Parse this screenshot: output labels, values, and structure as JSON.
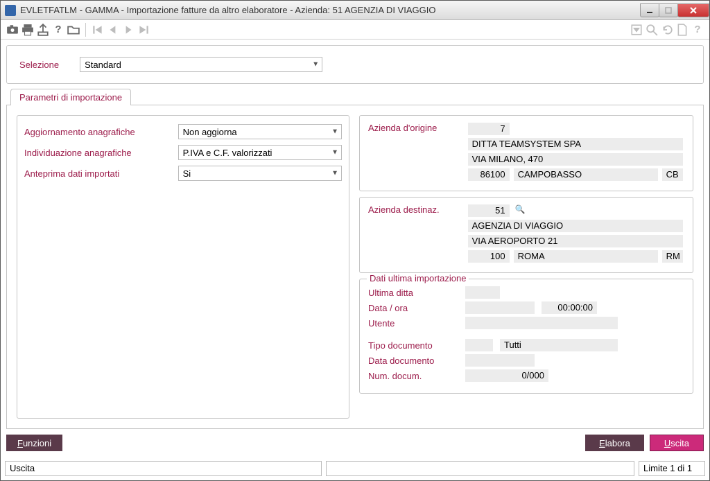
{
  "window": {
    "title": "EVLETFATLM - GAMMA - Importazione fatture da altro elaboratore - Azienda:   51 AGENZIA DI VIAGGIO"
  },
  "selection": {
    "label": "Selezione",
    "value": "Standard"
  },
  "tab": {
    "label": "Parametri di importazione"
  },
  "left": {
    "aggiornamento": {
      "label": "Aggiornamento anagrafiche",
      "value": "Non aggiorna"
    },
    "individuazione": {
      "label": "Individuazione anagrafiche",
      "value": "P.IVA e C.F. valorizzati"
    },
    "anteprima": {
      "label": "Anteprima dati importati",
      "value": "Si"
    }
  },
  "origine": {
    "label": "Azienda d'origine",
    "code": "7",
    "name": "DITTA TEAMSYSTEM SPA",
    "address": "VIA MILANO, 470",
    "cap": "86100",
    "city": "CAMPOBASSO",
    "prov": "CB"
  },
  "destinaz": {
    "label": "Azienda destinaz.",
    "code": "51",
    "name": "AGENZIA DI VIAGGIO",
    "address": "VIA AEROPORTO 21",
    "cap": "100",
    "city": "ROMA",
    "prov": "RM"
  },
  "ultima": {
    "legend": "Dati ultima importazione",
    "ditta": {
      "label": "Ultima ditta",
      "value": ""
    },
    "dataora": {
      "label": "Data / ora",
      "date": "",
      "time": "00:00:00"
    },
    "utente": {
      "label": "Utente",
      "value": ""
    },
    "tipodoc": {
      "label": "Tipo documento",
      "value": "Tutti"
    },
    "datadoc": {
      "label": "Data documento",
      "value": ""
    },
    "numdoc": {
      "label": "Num. docum.",
      "value": "0/000"
    }
  },
  "buttons": {
    "funzioni": "Funzioni",
    "elabora": "Elabora",
    "uscita": "Uscita"
  },
  "status": {
    "left": "Uscita",
    "right": "Limite 1 di 1"
  }
}
